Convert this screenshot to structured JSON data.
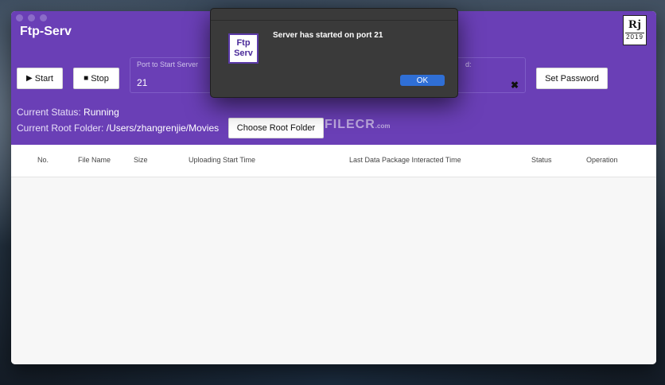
{
  "window": {
    "title": "Ftp-Serv",
    "logo": {
      "monogram": "Rj",
      "year": "2019"
    }
  },
  "controls": {
    "start_label": "Start",
    "start_icon": "play-icon",
    "stop_label": "Stop",
    "stop_icon": "stop-icon",
    "port_label": "Port to Start Server",
    "port_value": "21",
    "password_label_partial": "d:",
    "clear_icon": "close-icon",
    "set_password_label": "Set Password",
    "choose_root_label": "Choose Root Folder"
  },
  "status": {
    "current_status_label": "Current Status:",
    "current_status_value": "Running",
    "root_folder_label": "Current Root Folder:",
    "root_folder_value": "/Users/zhangrenjie/Movies"
  },
  "table": {
    "columns": [
      "No.",
      "File Name",
      "Size",
      "Uploading Start Time",
      "Last Data Package Interacted Time",
      "Status",
      "Operation"
    ],
    "rows": []
  },
  "dialog": {
    "icon_text_line1": "Ftp",
    "icon_text_line2": "Serv",
    "message": "Server has started on port 21",
    "ok_label": "OK"
  },
  "watermark": {
    "text": "FILECR",
    "suffix": ".com"
  },
  "colors": {
    "header": "#6a3fb6",
    "ok_button": "#2f6fd6",
    "dialog_bg": "#3a3a3a"
  }
}
